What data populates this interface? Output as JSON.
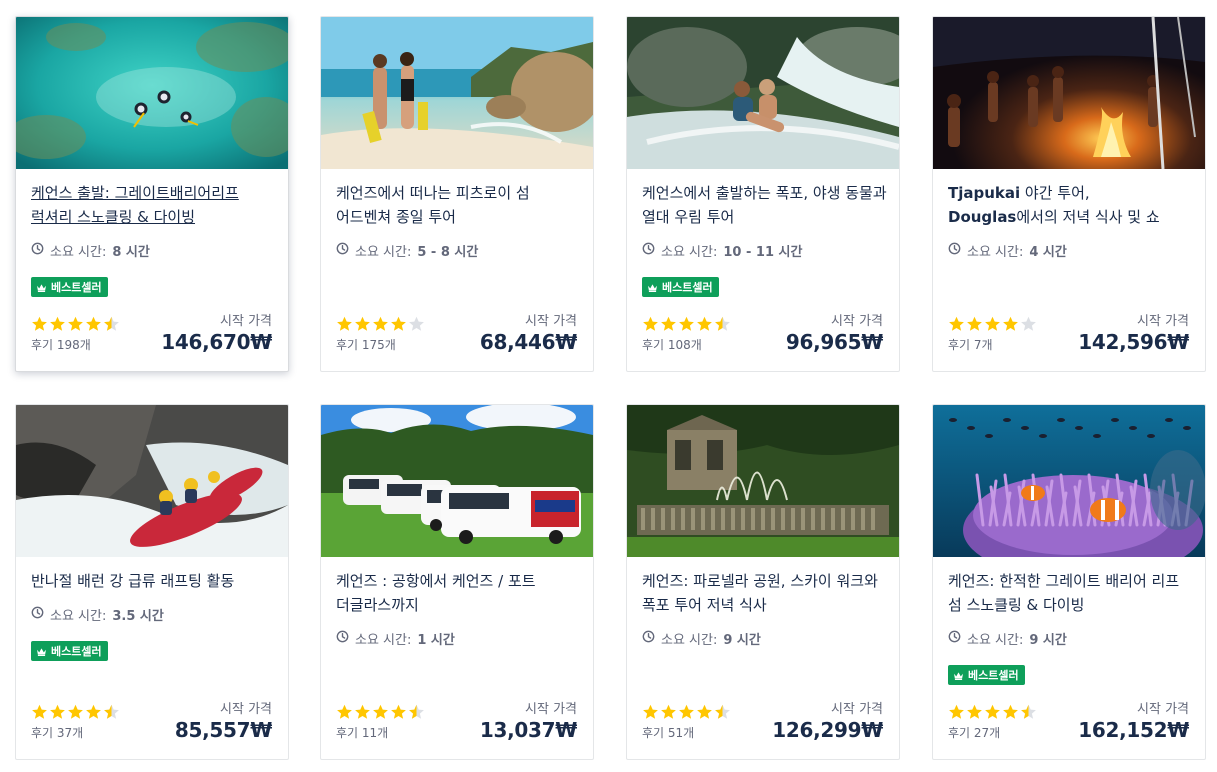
{
  "colors": {
    "star": "#ffc600",
    "star_empty": "#dcdfe4",
    "bestseller": "#0e9f5a",
    "text_primary": "#1a2b49",
    "text_muted": "#63687a"
  },
  "cards": [
    {
      "title": "케언스 출발: 그레이트배리어리프 럭셔리 스노클링 & 다이빙",
      "duration_label": "소요 시간:",
      "duration_value": "8 시간",
      "badge": "베스트셀러",
      "rating": 4.5,
      "reviews": "후기 198개",
      "from_label": "시작 가격",
      "price": "146,670₩",
      "image": "snorkelers-turquoise-reef",
      "hovered": true
    },
    {
      "title": "케언즈에서 떠나는 피츠로이 섬 어드벤쳐 종일 투어",
      "duration_label": "소요 시간:",
      "duration_value": "5 - 8 시간",
      "badge": null,
      "rating": 4.0,
      "reviews": "후기 175개",
      "from_label": "시작 가격",
      "price": "68,446₩",
      "image": "couple-beach-boulders",
      "hovered": false
    },
    {
      "title": "케언스에서 출발하는 폭포, 야생 동물과 열대 우림 투어",
      "duration_label": "소요 시간:",
      "duration_value": "10 - 11 시간",
      "badge": "베스트셀러",
      "rating": 4.5,
      "reviews": "후기 108개",
      "from_label": "시작 가격",
      "price": "96,965₩",
      "image": "couple-waterfall-slide",
      "hovered": false
    },
    {
      "title_parts": [
        "Tjapukai",
        " 야간 투어, ",
        "Douglas",
        "에서의 저녁 식사 및 쇼"
      ],
      "title": "Tjapukai 야간 투어, Douglas에서의 저녁 식사 및 쇼",
      "duration_label": "소요 시간:",
      "duration_value": "4 시간",
      "badge": null,
      "rating": 4.0,
      "reviews": "후기 7개",
      "from_label": "시작 가격",
      "price": "142,596₩",
      "image": "campfire-night-dance",
      "hovered": false
    },
    {
      "title": "반나절 배런 강 급류 래프팅 활동",
      "duration_label": "소요 시간:",
      "duration_value": "3.5 시간",
      "badge": "베스트셀러",
      "rating": 4.5,
      "reviews": "후기 37개",
      "from_label": "시작 가격",
      "price": "85,557₩",
      "image": "whitewater-raft",
      "hovered": false
    },
    {
      "title": "케언즈 : 공항에서 케언즈 / 포트 더글라스까지",
      "duration_label": "소요 시간:",
      "duration_value": "1 시간",
      "badge": null,
      "rating": 4.5,
      "reviews": "후기 11개",
      "from_label": "시작 가격",
      "price": "13,037₩",
      "image": "shuttle-vans-field",
      "hovered": false
    },
    {
      "title": "케언즈: 파로넬라 공원, 스카이 워크와 폭포 투어 저녁 식사",
      "duration_label": "소요 시간:",
      "duration_value": "9 시간",
      "badge": null,
      "rating": 4.5,
      "reviews": "후기 51개",
      "from_label": "시작 가격",
      "price": "126,299₩",
      "image": "paronella-fountain",
      "hovered": false
    },
    {
      "title": "케언즈: 한적한 그레이트 배리어 리프 섬 스노클링 & 다이빙",
      "duration_label": "소요 시간:",
      "duration_value": "9 시간",
      "badge": "베스트셀러",
      "rating": 4.5,
      "reviews": "후기 27개",
      "from_label": "시작 가격",
      "price": "162,152₩",
      "image": "clownfish-anemone",
      "hovered": false
    }
  ]
}
